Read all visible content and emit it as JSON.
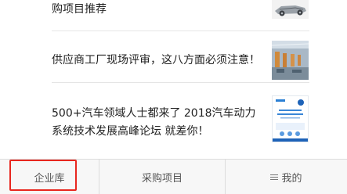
{
  "articles": [
    {
      "title": "购项目推荐",
      "thumb_icon": "car-chassis-image"
    },
    {
      "title": "供应商工厂现场评审，这八方面必须注意！",
      "thumb_icon": "factory-floor-image"
    },
    {
      "title": "500+汽车领域人士都来了 2018汽车动力系统技术发展高峰论坛 就差你！",
      "thumb_icon": "forum-poster-image"
    }
  ],
  "tabbar": {
    "tab1": "企业库",
    "tab2": "采购项目",
    "tab3": "我的",
    "tab3_icon": "menu-icon"
  },
  "colors": {
    "highlight": "#e8271f",
    "tabbar_bg": "#f7f7f7"
  }
}
